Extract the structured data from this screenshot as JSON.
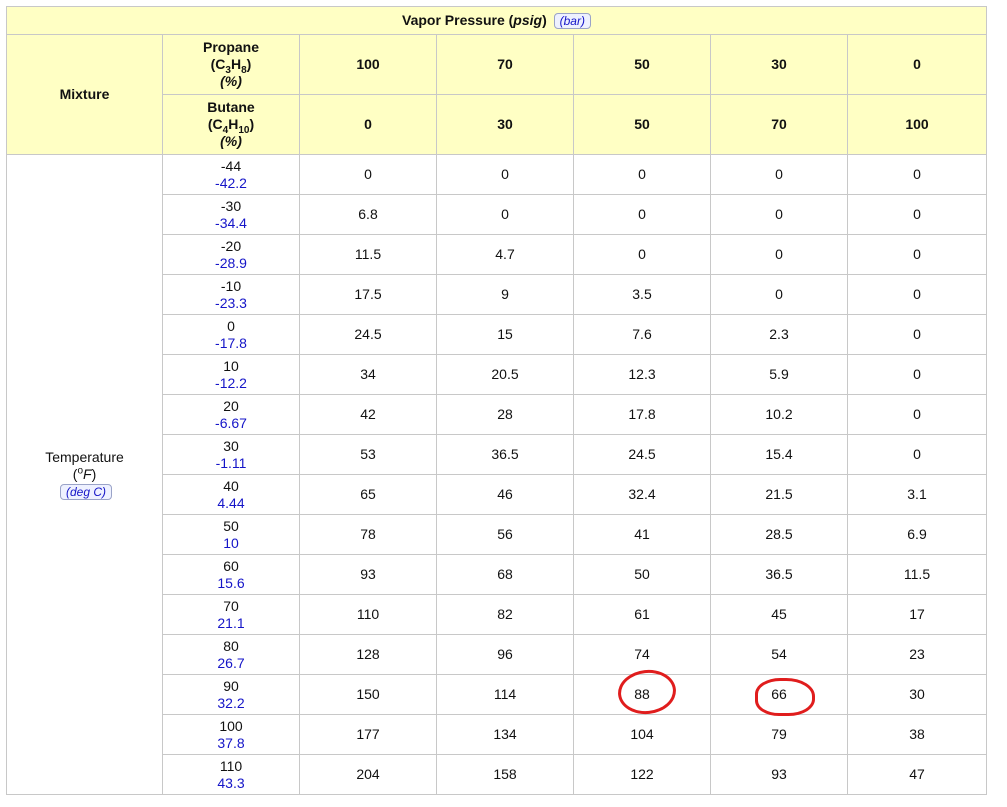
{
  "title": {
    "text": "Vapor Pressure",
    "unit": "psig",
    "toggle": "(bar)"
  },
  "header": {
    "mixture": "Mixture",
    "propane": {
      "name": "Propane",
      "formula_a": "(C",
      "sub1": "3",
      "formula_b": "H",
      "sub2": "8",
      "formula_c": ")",
      "pct": "(%)"
    },
    "butane": {
      "name": "Butane",
      "formula_a": "(C",
      "sub1": "4",
      "formula_b": "H",
      "sub2": "10",
      "formula_c": ")",
      "pct": "(%)"
    },
    "propane_pcts": [
      "100",
      "70",
      "50",
      "30",
      "0"
    ],
    "butane_pcts": [
      "0",
      "30",
      "50",
      "70",
      "100"
    ]
  },
  "temperature": {
    "label": "Temperature",
    "unit_open": "(",
    "unit_sup": "o",
    "unit_f": "F",
    "unit_close": ")",
    "toggle": "(deg C)"
  },
  "rows": [
    {
      "f": "-44",
      "c": "-42.2",
      "vals": [
        "0",
        "0",
        "0",
        "0",
        "0"
      ]
    },
    {
      "f": "-30",
      "c": "-34.4",
      "vals": [
        "6.8",
        "0",
        "0",
        "0",
        "0"
      ]
    },
    {
      "f": "-20",
      "c": "-28.9",
      "vals": [
        "11.5",
        "4.7",
        "0",
        "0",
        "0"
      ]
    },
    {
      "f": "-10",
      "c": "-23.3",
      "vals": [
        "17.5",
        "9",
        "3.5",
        "0",
        "0"
      ]
    },
    {
      "f": "0",
      "c": "-17.8",
      "vals": [
        "24.5",
        "15",
        "7.6",
        "2.3",
        "0"
      ]
    },
    {
      "f": "10",
      "c": "-12.2",
      "vals": [
        "34",
        "20.5",
        "12.3",
        "5.9",
        "0"
      ]
    },
    {
      "f": "20",
      "c": "-6.67",
      "vals": [
        "42",
        "28",
        "17.8",
        "10.2",
        "0"
      ]
    },
    {
      "f": "30",
      "c": "-1.11",
      "vals": [
        "53",
        "36.5",
        "24.5",
        "15.4",
        "0"
      ]
    },
    {
      "f": "40",
      "c": "4.44",
      "vals": [
        "65",
        "46",
        "32.4",
        "21.5",
        "3.1"
      ]
    },
    {
      "f": "50",
      "c": "10",
      "vals": [
        "78",
        "56",
        "41",
        "28.5",
        "6.9"
      ]
    },
    {
      "f": "60",
      "c": "15.6",
      "vals": [
        "93",
        "68",
        "50",
        "36.5",
        "11.5"
      ]
    },
    {
      "f": "70",
      "c": "21.1",
      "vals": [
        "110",
        "82",
        "61",
        "45",
        "17"
      ]
    },
    {
      "f": "80",
      "c": "26.7",
      "vals": [
        "128",
        "96",
        "74",
        "54",
        "23"
      ]
    },
    {
      "f": "90",
      "c": "32.2",
      "vals": [
        "150",
        "114",
        "88",
        "66",
        "30"
      ]
    },
    {
      "f": "100",
      "c": "37.8",
      "vals": [
        "177",
        "134",
        "104",
        "79",
        "38"
      ]
    },
    {
      "f": "110",
      "c": "43.3",
      "vals": [
        "204",
        "158",
        "122",
        "93",
        "47"
      ]
    }
  ],
  "colors": {
    "header_bg": "#ffffc4",
    "celsius_text": "#1515c8",
    "annotation_circle": "#e01d1d",
    "grid": "#c8c8c8"
  }
}
